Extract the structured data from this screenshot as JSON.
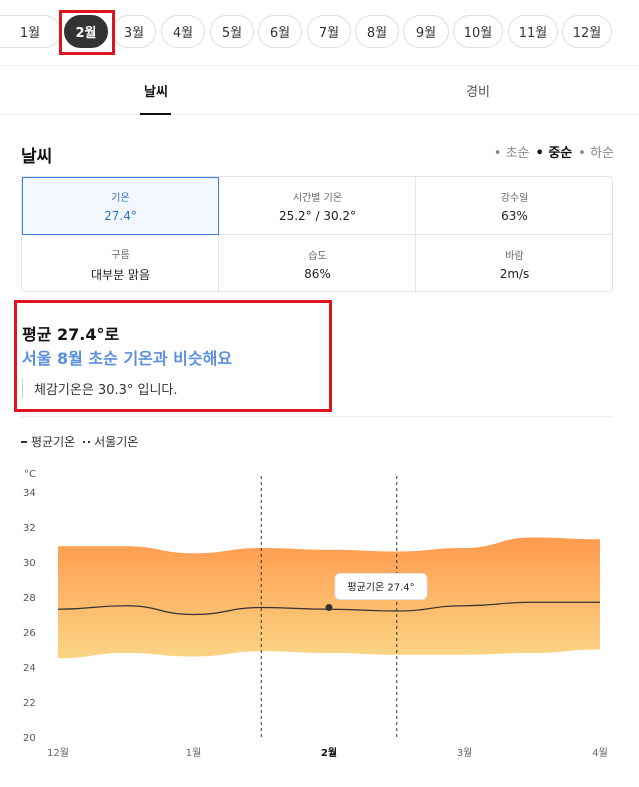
{
  "months": {
    "items": [
      "1월",
      "2월",
      "3월",
      "4월",
      "5월",
      "6월",
      "7월",
      "8월",
      "9월",
      "10월",
      "11월",
      "12월"
    ],
    "selected": "2월"
  },
  "tabs": [
    "날씨",
    "경비"
  ],
  "section": {
    "title": "날씨",
    "periods": [
      "• 초순",
      "• 중순",
      "• 하순"
    ],
    "selected_period": "• 중순"
  },
  "stats": [
    {
      "label": "기온",
      "value": "27.4°"
    },
    {
      "label": "시간별 기온",
      "value": "25.2° / 30.2°"
    },
    {
      "label": "강수일",
      "value": "63%"
    },
    {
      "label": "구름",
      "value": "대부분 맑음"
    },
    {
      "label": "습도",
      "value": "86%"
    },
    {
      "label": "바람",
      "value": "2m/s"
    }
  ],
  "summary": {
    "line1": "평균 27.4°로",
    "line2": "서울 8월 초순 기온과 비슷해요",
    "line3": "체감기온은 30.3° 입니다."
  },
  "legend": {
    "avg": "평균기온",
    "seoul": "서울기온"
  },
  "colors": {
    "accent_blue": "#3b82e0",
    "highlight_red": "#e0141e",
    "band_top": "#ff9a4d",
    "band_bottom": "#fbd585"
  },
  "chart_data": {
    "type": "area",
    "ylabel": "°C",
    "ylim": [
      20,
      34
    ],
    "yticks": [
      20,
      22,
      24,
      26,
      28,
      30,
      32,
      34
    ],
    "x": [
      0,
      0.5,
      1,
      1.5,
      2,
      2.5,
      3,
      3.5,
      4
    ],
    "xtick_labels": [
      "12월",
      "1월",
      "2월",
      "3월",
      "4월"
    ],
    "xtick_positions": [
      0,
      1,
      2,
      3,
      4
    ],
    "xtick_bold": "2월",
    "series": [
      {
        "name": "평균기온",
        "values": [
          27.3,
          27.5,
          27.0,
          27.4,
          27.3,
          27.2,
          27.5,
          27.7,
          27.7
        ]
      },
      {
        "role": "max",
        "values": [
          30.9,
          30.9,
          30.5,
          30.8,
          30.7,
          30.6,
          30.8,
          31.4,
          31.3
        ]
      },
      {
        "role": "min",
        "values": [
          24.5,
          24.8,
          24.6,
          24.9,
          24.8,
          24.7,
          24.7,
          24.8,
          25.0
        ]
      }
    ],
    "highlight_range": [
      1.5,
      2.5
    ],
    "tooltip": {
      "x": 2,
      "y": 27.4,
      "text": "평균기온 27.4°"
    }
  }
}
